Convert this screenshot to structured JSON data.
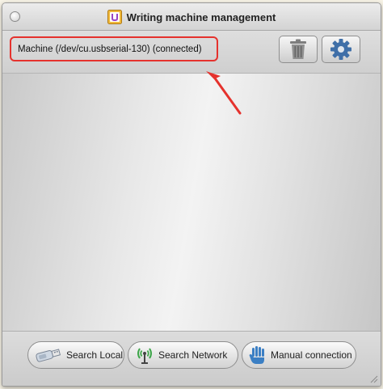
{
  "window": {
    "title": "Writing machine management"
  },
  "machine": {
    "label": "Machine (/dev/cu.usbserial-130) (connected)"
  },
  "toolbar": {
    "delete_icon": "trash-icon",
    "settings_icon": "gear-icon"
  },
  "buttons": {
    "search_local": "Search Local",
    "search_network": "Search Network",
    "manual_connection": "Manual connection"
  },
  "colors": {
    "highlight": "#e5322d",
    "arrow": "#e5322d"
  }
}
